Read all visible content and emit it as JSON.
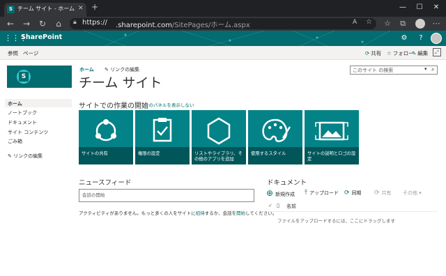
{
  "browser": {
    "tab_title": "チーム サイト - ホーム",
    "tab_close": "✕",
    "new_tab": "+",
    "url_scheme": "https://",
    "url_host": ".sharepoint.com",
    "url_path": "/SitePages/ホーム.aspx",
    "window_controls": [
      "—",
      "☐",
      "✕"
    ]
  },
  "suite": {
    "app_name": "SharePoint",
    "settings_icon": "gear-icon",
    "help_label": "?"
  },
  "commandbar": {
    "left": [
      "参照",
      "ページ"
    ],
    "share": "共有",
    "follow": "フォロー",
    "edit": "編集"
  },
  "header": {
    "logo_letter": "S",
    "nav_home": "ホーム",
    "edit_links": "リンクの編集",
    "site_title": "チーム サイト",
    "search_placeholder": "このサイト の検索"
  },
  "leftnav": {
    "items": [
      "ホーム",
      "ノートブック",
      "ドキュメント",
      "サイト コンテンツ",
      "ごみ箱"
    ],
    "edit_links": "リンクの編集"
  },
  "getting_started": {
    "title": "サイトでの作業の開始",
    "hide": "このパネルを表示しない",
    "tiles": [
      {
        "label": "サイトの共有",
        "icon": "share-network-icon"
      },
      {
        "label": "権限の設定",
        "icon": "clipboard-check-icon"
      },
      {
        "label": "リストやライブラリ、その他のアプリを追加",
        "icon": "hexagon-apps-icon"
      },
      {
        "label": "使用するスタイル",
        "icon": "palette-icon"
      },
      {
        "label": "サイトの説明とロゴの設定",
        "icon": "picture-frame-icon"
      }
    ]
  },
  "newsfeed": {
    "title": "ニュースフィード",
    "placeholder": "会話の開始",
    "activity_before": "アクティビティがありません。もっと多くの人をサイトに",
    "activity_link1": "招待",
    "activity_mid": "するか、会話を",
    "activity_link2": "開始",
    "activity_after": "してください。"
  },
  "documents": {
    "title": "ドキュメント",
    "new": "新規作成",
    "upload": "アップロード",
    "sync": "同期",
    "share": "共有",
    "more": "その他",
    "name_col": "名前",
    "drop_hint": "ファイルをアップロードするには、ここにドラッグします"
  },
  "colors": {
    "accent": "#036c70",
    "tile": "#038387",
    "chrome_dark": "#202124"
  }
}
